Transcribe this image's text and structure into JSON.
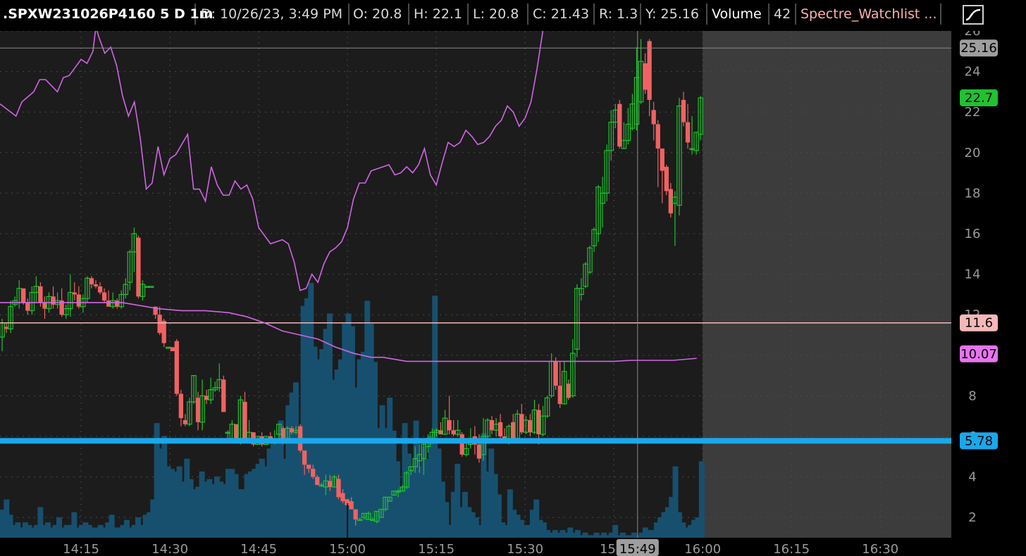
{
  "header": {
    "symbol": ".SPXW231026P4160 5 D 1m",
    "date": "D: 10/26/23, 3:49 PM",
    "open": "O: 20.8",
    "high": "H: 22.1",
    "low": "L: 20.8",
    "close": "C: 21.43",
    "range": "R: 1.3",
    "y": "Y: 25.16",
    "volume_label": "Volume",
    "volume_value": "42",
    "watchlist": "Spectre_Watchlist ...",
    "study_icon": "studies-curve-icon"
  },
  "chart_data": {
    "type": "candlestick",
    "title": "",
    "xlabel": "",
    "ylabel": "",
    "ylim": [
      1.0,
      26.0
    ],
    "y_ticks": [
      2,
      4,
      6,
      8,
      10,
      12,
      14,
      16,
      18,
      20,
      22,
      24,
      26
    ],
    "x_ticks": [
      "14:15",
      "14:30",
      "14:45",
      "15:00",
      "15:15",
      "15:30",
      "15:4",
      "16:00",
      "16:15",
      "16:30"
    ],
    "x_tick_minutes": [
      855,
      870,
      885,
      900,
      915,
      930,
      945,
      960,
      975,
      990
    ],
    "x_range_minutes": [
      841.3,
      1002.0
    ],
    "cursor_label": "15:49",
    "cursor_minute": 949,
    "market_close_minute": 960,
    "series_colors": {
      "up": "#1fc22f",
      "down": "#f06262",
      "volume": "#17506e",
      "main_line": "#d264e6",
      "price_line": "#f5b8b8",
      "level_line": "#1aa8ec"
    },
    "candles": [
      [
        10.9,
        11.6,
        10.2,
        11.8
      ],
      [
        11.4,
        11.3,
        11.1,
        11.6
      ],
      [
        11.3,
        12.4,
        11.1,
        12.7
      ],
      [
        12.5,
        12.7,
        12.4,
        12.9
      ],
      [
        12.6,
        13.3,
        12.3,
        13.7
      ],
      [
        13.3,
        12.6,
        12.5,
        13.3
      ],
      [
        12.6,
        12.2,
        12.0,
        12.8
      ],
      [
        12.2,
        13.1,
        12.0,
        13.4
      ],
      [
        13.1,
        13.4,
        12.6,
        13.9
      ],
      [
        13.4,
        12.6,
        12.4,
        13.6
      ],
      [
        12.6,
        12.3,
        11.8,
        12.9
      ],
      [
        12.3,
        12.9,
        12.1,
        13.1
      ],
      [
        12.9,
        12.5,
        12.3,
        13.4
      ],
      [
        12.5,
        12.7,
        12.3,
        13.1
      ],
      [
        12.7,
        12.0,
        11.9,
        13.3
      ],
      [
        12.0,
        12.3,
        11.8,
        12.5
      ],
      [
        12.3,
        13.1,
        11.9,
        14.0
      ],
      [
        13.1,
        13.0,
        12.7,
        13.6
      ],
      [
        13.0,
        12.4,
        12.3,
        13.4
      ],
      [
        12.4,
        12.8,
        12.1,
        13.0
      ],
      [
        12.8,
        13.8,
        12.6,
        13.9
      ],
      [
        13.8,
        13.5,
        13.3,
        13.9
      ],
      [
        13.5,
        13.4,
        13.3,
        13.7
      ],
      [
        13.4,
        13.1,
        13.0,
        13.6
      ],
      [
        13.1,
        12.7,
        12.6,
        13.3
      ],
      [
        12.7,
        12.4,
        12.4,
        13.2
      ],
      [
        12.4,
        12.7,
        12.3,
        13.1
      ],
      [
        12.7,
        12.4,
        12.3,
        12.8
      ],
      [
        12.4,
        13.0,
        12.3,
        13.2
      ],
      [
        13.0,
        13.5,
        12.8,
        13.8
      ],
      [
        13.6,
        15.1,
        13.2,
        15.2
      ],
      [
        15.1,
        16.0,
        14.1,
        16.3
      ],
      [
        15.8,
        12.9,
        12.8,
        15.9
      ],
      [
        12.9,
        13.5,
        12.7,
        13.7
      ],
      [
        13.4,
        13.4,
        13.4,
        13.4
      ],
      [
        13.4,
        13.4,
        13.4,
        13.4
      ],
      [
        12.4,
        12.0,
        11.8,
        12.4
      ],
      [
        12.0,
        11.1,
        11.0,
        12.4
      ],
      [
        11.7,
        10.6,
        10.4,
        11.8
      ],
      [
        10.4,
        10.4,
        10.3,
        10.4
      ],
      [
        10.4,
        10.2,
        10.2,
        10.2
      ],
      [
        10.7,
        8.1,
        8.0,
        10.8
      ],
      [
        8.1,
        6.9,
        6.5,
        8.3
      ],
      [
        6.8,
        6.6,
        6.5,
        7.1
      ],
      [
        6.6,
        7.7,
        6.5,
        7.9
      ],
      [
        7.7,
        9.0,
        7.6,
        9.0
      ],
      [
        7.9,
        6.7,
        6.3,
        8.2
      ],
      [
        6.7,
        8.0,
        6.3,
        8.8
      ],
      [
        8.0,
        7.8,
        7.6,
        8.3
      ],
      [
        7.8,
        8.3,
        7.6,
        8.9
      ],
      [
        8.3,
        8.4,
        8.2,
        8.7
      ],
      [
        8.4,
        8.8,
        8.2,
        9.6
      ],
      [
        8.8,
        7.2,
        7.2,
        9.0
      ],
      [
        6.2,
        6.2,
        5.8,
        6.3
      ],
      [
        5.8,
        6.6,
        5.8,
        6.8
      ],
      [
        6.6,
        5.9,
        5.8,
        6.6
      ],
      [
        5.9,
        7.8,
        5.6,
        8.0
      ],
      [
        7.7,
        5.9,
        5.8,
        8.2
      ],
      [
        5.9,
        6.2,
        5.8,
        6.8
      ],
      [
        6.2,
        5.6,
        5.5,
        6.2
      ],
      [
        5.6,
        6.0,
        5.6,
        6.0
      ],
      [
        6.0,
        5.6,
        5.5,
        6.2
      ],
      [
        5.6,
        6.0,
        5.6,
        6.0
      ],
      [
        6.0,
        5.8,
        5.7,
        6.2
      ],
      [
        5.8,
        5.8,
        5.6,
        6.3
      ],
      [
        6.1,
        6.6,
        5.9,
        6.6
      ],
      [
        6.4,
        5.9,
        5.6,
        6.5
      ],
      [
        5.9,
        6.4,
        5.8,
        6.5
      ],
      [
        6.4,
        6.2,
        6.1,
        6.5
      ],
      [
        6.2,
        6.3,
        6.1,
        6.5
      ],
      [
        6.5,
        5.3,
        5.2,
        6.6
      ],
      [
        5.3,
        4.6,
        4.1,
        5.2
      ],
      [
        4.6,
        4.4,
        4.2,
        4.6
      ],
      [
        4.4,
        4.0,
        3.9,
        4.6
      ],
      [
        4.0,
        3.6,
        3.6,
        4.1
      ],
      [
        3.6,
        3.6,
        3.5,
        3.7
      ],
      [
        3.5,
        3.8,
        3.1,
        4.1
      ],
      [
        3.8,
        3.5,
        3.3,
        4.1
      ],
      [
        3.5,
        4.0,
        3.5,
        4.1
      ],
      [
        3.9,
        3.0,
        2.9,
        4.1
      ],
      [
        3.2,
        2.8,
        2.7,
        3.4
      ],
      [
        2.9,
        2.6,
        2.6,
        2.8
      ],
      [
        2.8,
        2.4,
        2.4,
        3.0
      ],
      [
        2.4,
        1.9,
        1.6,
        2.4
      ],
      [
        1.9,
        1.9,
        1.9,
        2.0
      ],
      [
        2.0,
        2.2,
        1.9,
        2.2
      ],
      [
        1.9,
        2.2,
        1.9,
        2.3
      ],
      [
        1.9,
        1.9,
        1.9,
        2.0
      ],
      [
        1.8,
        2.3,
        1.7,
        2.3
      ],
      [
        2.0,
        2.4,
        2.0,
        2.4
      ],
      [
        2.4,
        3.0,
        2.3,
        3.0
      ],
      [
        2.8,
        3.0,
        2.8,
        3.0
      ],
      [
        3.1,
        3.3,
        3.1,
        3.3
      ],
      [
        3.3,
        3.3,
        3.0,
        3.4
      ],
      [
        3.3,
        3.5,
        3.3,
        3.6
      ],
      [
        3.5,
        4.2,
        3.4,
        4.3
      ],
      [
        4.3,
        4.5,
        4.1,
        4.5
      ],
      [
        4.5,
        4.9,
        4.2,
        5.5
      ],
      [
        4.8,
        5.1,
        4.2,
        5.6
      ],
      [
        4.9,
        5.6,
        4.1,
        5.9
      ],
      [
        5.5,
        5.9,
        5.2,
        6.1
      ],
      [
        5.9,
        6.2,
        5.8,
        6.4
      ],
      [
        6.2,
        6.3,
        6.0,
        6.4
      ],
      [
        6.3,
        6.1,
        6.1,
        6.7
      ],
      [
        6.1,
        6.9,
        6.1,
        7.3
      ],
      [
        6.8,
        6.3,
        6.1,
        8.0
      ],
      [
        6.3,
        6.1,
        6.0,
        6.8
      ],
      [
        6.1,
        6.3,
        6.0,
        6.8
      ],
      [
        6.1,
        5.1,
        5.0,
        6.2
      ],
      [
        5.1,
        5.4,
        5.0,
        5.9
      ],
      [
        5.6,
        5.9,
        5.4,
        6.4
      ],
      [
        6.0,
        5.6,
        5.1,
        6.5
      ],
      [
        5.6,
        4.9,
        4.7,
        6.1
      ],
      [
        5.1,
        6.0,
        4.8,
        6.9
      ],
      [
        6.0,
        6.8,
        5.9,
        6.9
      ],
      [
        6.8,
        6.3,
        6.1,
        7.0
      ],
      [
        6.3,
        6.6,
        6.0,
        6.9
      ],
      [
        6.7,
        6.0,
        5.9,
        7.1
      ],
      [
        6.0,
        5.8,
        5.8,
        6.4
      ],
      [
        5.8,
        6.5,
        5.6,
        6.6
      ],
      [
        6.7,
        5.9,
        5.8,
        7.1
      ],
      [
        5.9,
        7.1,
        5.9,
        7.3
      ],
      [
        7.1,
        6.2,
        6.1,
        7.6
      ],
      [
        6.2,
        6.8,
        6.1,
        7.0
      ],
      [
        6.8,
        6.2,
        6.0,
        7.1
      ],
      [
        6.2,
        7.3,
        6.1,
        7.8
      ],
      [
        7.3,
        6.1,
        5.6,
        7.6
      ],
      [
        6.1,
        7.0,
        6.0,
        7.5
      ],
      [
        7.0,
        7.9,
        6.9,
        8.0
      ],
      [
        8.0,
        9.7,
        7.9,
        10.1
      ],
      [
        9.7,
        8.5,
        8.3,
        9.9
      ],
      [
        8.5,
        7.6,
        7.4,
        9.7
      ],
      [
        7.6,
        9.2,
        7.6,
        9.7
      ],
      [
        8.6,
        7.9,
        7.8,
        8.8
      ],
      [
        8.0,
        10.1,
        7.9,
        10.8
      ],
      [
        10.3,
        13.3,
        9.9,
        13.5
      ],
      [
        13.0,
        13.3,
        12.7,
        13.8
      ],
      [
        13.4,
        14.5,
        13.3,
        14.6
      ],
      [
        14.1,
        15.3,
        14.0,
        15.4
      ],
      [
        15.4,
        16.2,
        15.1,
        16.3
      ],
      [
        16.0,
        18.3,
        15.6,
        18.4
      ],
      [
        17.5,
        18.0,
        16.3,
        18.8
      ],
      [
        18.0,
        20.1,
        17.6,
        20.4
      ],
      [
        20.1,
        21.5,
        19.6,
        22.1
      ],
      [
        21.5,
        22.1,
        21.2,
        22.4
      ],
      [
        22.4,
        20.3,
        20.2,
        22.6
      ],
      [
        20.2,
        20.6,
        20.2,
        21.5
      ],
      [
        20.6,
        21.4,
        20.4,
        22.2
      ],
      [
        21.2,
        22.4,
        21.1,
        22.9
      ],
      [
        21.4,
        23.7,
        21.1,
        25.2
      ],
      [
        22.5,
        24.5,
        22.4,
        25.6
      ],
      [
        24.4,
        23.1,
        22.9,
        24.9
      ],
      [
        25.5,
        22.6,
        21.8,
        25.6
      ],
      [
        22.1,
        21.4,
        20.6,
        22.5
      ],
      [
        21.4,
        20.2,
        18.3,
        21.6
      ],
      [
        20.2,
        19.1,
        17.5,
        19.7
      ],
      [
        19.3,
        18.1,
        17.9,
        19.4
      ],
      [
        18.2,
        17.0,
        16.8,
        18.5
      ],
      [
        17.5,
        17.8,
        15.4,
        18.1
      ],
      [
        17.4,
        22.3,
        16.9,
        22.7
      ],
      [
        22.6,
        21.5,
        21.3,
        23.0
      ],
      [
        21.5,
        20.5,
        20.2,
        22.4
      ],
      [
        20.2,
        20.2,
        19.9,
        21.8
      ],
      [
        20.1,
        21.0,
        19.9,
        21.0
      ],
      [
        20.9,
        22.7,
        20.6,
        22.8
      ]
    ],
    "volume_fraction": [
      0.11,
      0.15,
      0.09,
      0.05,
      0.06,
      0.04,
      0.06,
      0.05,
      0.04,
      0.05,
      0.12,
      0.05,
      0.06,
      0.04,
      0.05,
      0.08,
      0.04,
      0.05,
      0.05,
      0.1,
      0.04,
      0.05,
      0.06,
      0.05,
      0.04,
      0.04,
      0.05,
      0.04,
      0.06,
      0.09,
      0.04,
      0.04,
      0.05,
      0.07,
      0.04,
      0.05,
      0.08,
      0.05,
      0.09,
      0.1,
      0.15,
      0.45,
      0.35,
      0.4,
      0.28,
      0.27,
      0.26,
      0.28,
      0.22,
      0.31,
      0.23,
      0.19,
      0.2,
      0.26,
      0.22,
      0.23,
      0.21,
      0.24,
      0.22,
      0.21,
      0.27,
      0.27,
      0.25,
      0.19,
      0.19,
      0.25,
      0.26,
      0.27,
      0.29,
      0.31,
      0.28,
      0.35,
      0.39,
      0.37,
      0.46,
      0.31,
      0.52,
      0.57,
      0.61,
      0.4,
      0.91,
      0.94,
      1.0,
      0.75,
      0.7,
      0.74,
      0.82,
      0.88,
      0.62,
      0.66,
      0.7,
      0.84,
      0.88,
      0.83,
      0.59,
      0.7,
      0.73,
      0.93,
      0.84,
      0.69,
      0.43,
      0.52,
      0.43,
      0.55,
      0.42,
      0.3,
      0.2,
      0.45,
      0.33,
      0.27,
      0.46,
      0.28,
      0.36,
      0.31,
      0.4,
      0.95,
      0.35,
      0.22,
      0.14,
      0.05,
      0.18,
      0.29,
      0.12,
      0.18,
      0.12,
      0.1,
      0.08,
      0.05,
      0.41,
      0.26,
      0.35,
      0.25,
      0.17,
      0.06,
      0.05,
      0.19,
      0.11,
      0.09,
      0.07,
      0.05,
      0.05,
      0.11,
      0.15,
      0.07,
      0.06,
      0.03,
      0.02,
      0.03,
      0.02,
      0.03,
      0.02,
      0.04,
      0.02,
      0.03,
      0.01,
      0.02,
      0.01,
      0.01,
      0.02,
      0.01,
      0.02,
      0.01,
      0.02,
      0.05,
      0.01,
      0.02,
      0.01,
      0.01,
      0.02,
      0.01,
      0.02,
      0.04,
      0.03,
      0.03,
      0.06,
      0.08,
      0.1,
      0.12,
      0.16,
      0.28,
      0.1,
      0.06,
      0.04,
      0.05,
      0.07,
      0.08,
      0.3
    ],
    "study_line_minute": [
      841.3,
      844,
      845,
      847,
      848,
      849,
      850,
      851,
      852,
      853,
      854,
      855,
      856,
      857,
      857.5,
      858,
      859,
      860,
      861,
      862,
      863,
      864,
      865,
      866,
      867,
      868,
      869,
      870,
      871,
      872,
      873,
      874,
      875,
      876,
      877,
      878,
      879,
      880,
      881,
      882,
      883,
      884,
      885,
      886,
      887,
      888,
      889,
      890,
      891,
      892,
      893,
      894,
      895,
      896,
      897,
      898,
      899,
      900,
      901,
      902,
      903,
      904,
      905,
      906,
      907,
      908,
      909,
      910,
      911,
      912,
      913,
      914,
      915,
      916,
      917,
      918,
      919,
      920,
      921,
      922,
      923,
      924,
      925,
      926,
      927,
      928,
      929,
      930,
      931,
      932,
      933
    ],
    "study_line_values": [
      22.4,
      21.8,
      22.5,
      23.0,
      23.6,
      23.6,
      23.3,
      23.0,
      23.7,
      23.8,
      24.2,
      24.6,
      24.4,
      25.0,
      26.2,
      25.7,
      24.9,
      25.2,
      24.3,
      22.8,
      21.8,
      22.5,
      20.7,
      18.2,
      18.5,
      20.3,
      18.9,
      19.7,
      19.9,
      20.4,
      20.9,
      18.2,
      18.2,
      17.6,
      19.3,
      18.4,
      17.9,
      17.9,
      18.6,
      18.2,
      18.4,
      17.7,
      16.3,
      15.9,
      15.5,
      15.6,
      15.7,
      15.5,
      14.6,
      13.2,
      13.3,
      14.0,
      13.6,
      14.5,
      15.1,
      15.3,
      15.6,
      16.3,
      17.7,
      18.5,
      18.5,
      19.1,
      19.2,
      19.3,
      19.4,
      18.9,
      19.0,
      19.3,
      19.0,
      19.4,
      20.2,
      18.9,
      18.4,
      19.5,
      20.5,
      20.3,
      20.5,
      21.1,
      20.8,
      20.4,
      20.5,
      20.8,
      21.3,
      21.6,
      22.3,
      22.0,
      21.3,
      21.7,
      22.5,
      24.1,
      26.0
    ],
    "ma_line": [
      [
        841.3,
        12.6
      ],
      [
        855,
        12.6
      ],
      [
        862,
        12.6
      ],
      [
        864,
        12.5
      ],
      [
        866,
        12.4
      ],
      [
        868,
        12.3
      ],
      [
        872,
        12.2
      ],
      [
        876,
        12.2
      ],
      [
        880,
        12.1
      ],
      [
        883,
        11.9
      ],
      [
        886,
        11.6
      ],
      [
        889,
        11.2
      ],
      [
        892,
        11.0
      ],
      [
        895,
        10.8
      ],
      [
        898,
        10.4
      ],
      [
        901,
        10.1
      ],
      [
        904,
        9.9
      ],
      [
        906,
        9.9
      ],
      [
        908,
        9.8
      ],
      [
        910,
        9.7
      ],
      [
        914,
        9.7
      ],
      [
        918,
        9.7
      ],
      [
        922,
        9.7
      ],
      [
        926,
        9.7
      ],
      [
        930,
        9.7
      ],
      [
        934,
        9.7
      ],
      [
        938,
        9.7
      ],
      [
        942,
        9.7
      ],
      [
        945,
        9.7
      ],
      [
        948,
        9.75
      ],
      [
        951,
        9.75
      ],
      [
        955,
        9.75
      ],
      [
        959,
        9.85
      ]
    ],
    "horizontal_lines": {
      "price_line": 11.6,
      "level_line": 5.78
    },
    "price_badges": [
      {
        "label": "25.16",
        "value": 25.16,
        "bg": "#9e9e9e",
        "fg": "#000000"
      },
      {
        "label": "22.7",
        "value": 22.7,
        "bg": "#1fc22f",
        "fg": "#000000"
      },
      {
        "label": "11.6",
        "value": 11.6,
        "bg": "#f5b8b8",
        "fg": "#000000"
      },
      {
        "label": "10.07",
        "value": 10.07,
        "bg": "#e774ee",
        "fg": "#000000"
      },
      {
        "label": "5.78",
        "value": 5.78,
        "bg": "#1aa8ec",
        "fg": "#000000"
      }
    ]
  }
}
